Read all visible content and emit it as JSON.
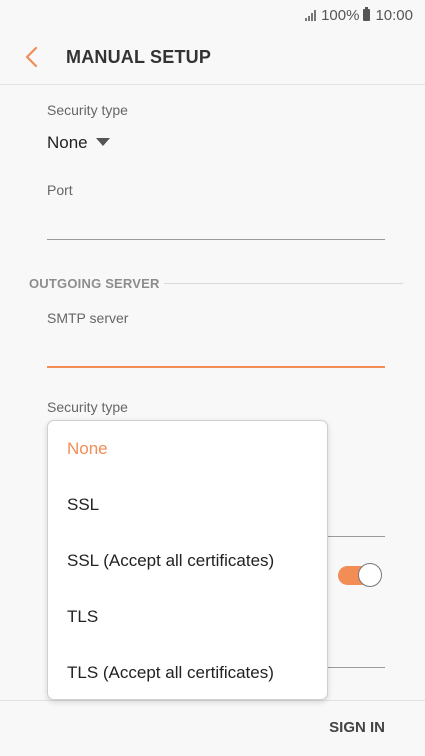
{
  "status_bar": {
    "battery": "100%",
    "time": "10:00"
  },
  "app_bar": {
    "title": "MANUAL SETUP"
  },
  "incoming": {
    "security_type_label": "Security type",
    "security_type_value": "None",
    "port_label": "Port",
    "port_value": ""
  },
  "outgoing": {
    "section_title": "OUTGOING SERVER",
    "smtp_label": "SMTP server",
    "smtp_value": "",
    "security_type_label": "Security type"
  },
  "dropdown": {
    "options": [
      {
        "label": "None",
        "selected": true
      },
      {
        "label": "SSL",
        "selected": false
      },
      {
        "label": "SSL (Accept all certificates)",
        "selected": false
      },
      {
        "label": "TLS",
        "selected": false
      },
      {
        "label": "TLS (Accept all certificates)",
        "selected": false
      }
    ]
  },
  "toggle": {
    "on": true
  },
  "bottom_bar": {
    "sign_in_label": "SIGN IN"
  },
  "colors": {
    "accent": "#f28d55",
    "background": "#f8f8f8"
  }
}
